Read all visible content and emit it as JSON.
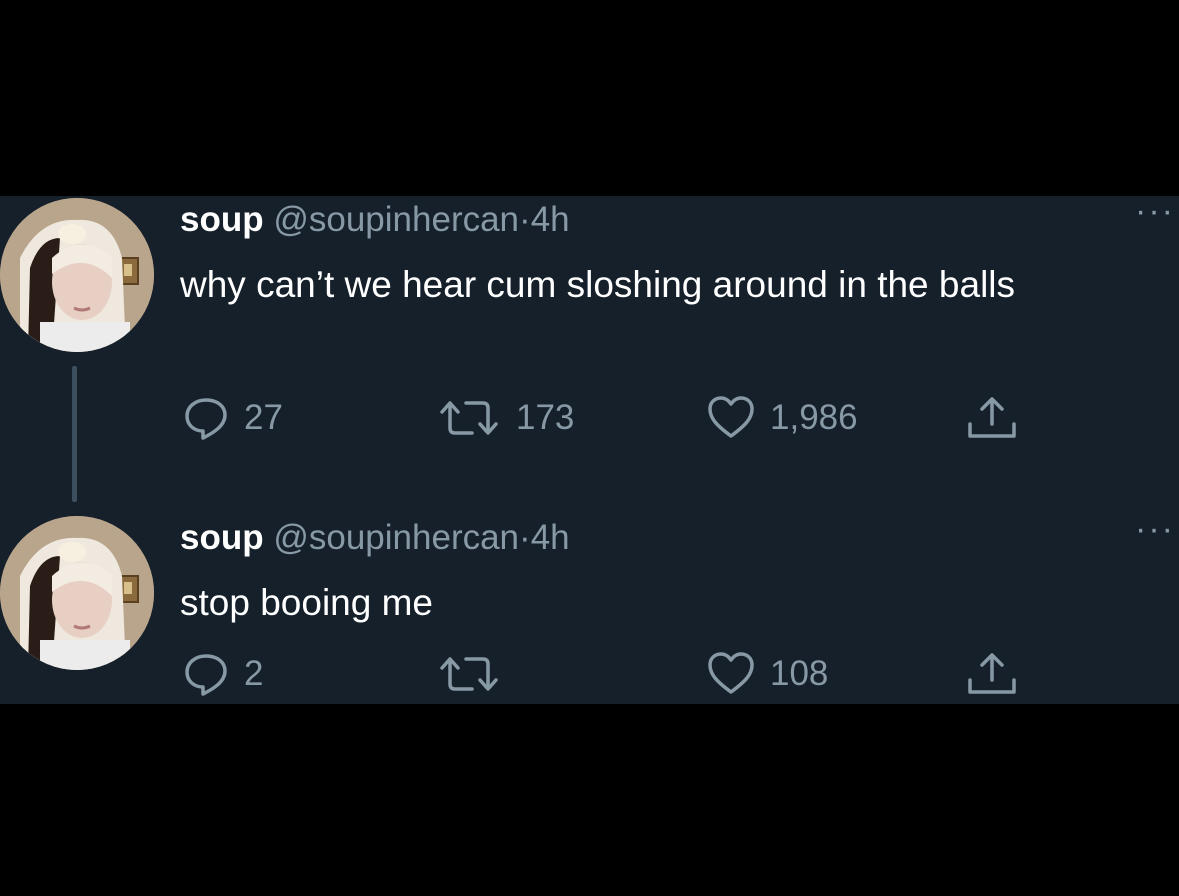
{
  "colors": {
    "background": "#15202b",
    "letterbox": "#000000",
    "text_primary": "#ffffff",
    "text_secondary": "#8899a6",
    "thread_line": "#3d4e5f"
  },
  "tweets": [
    {
      "name": "soup",
      "handle": "@soupinhercan",
      "separator": "·",
      "time": "4h",
      "more": "···",
      "text": "why can’t we hear cum sloshing around in the balls",
      "replies": "27",
      "retweets": "173",
      "likes": "1,986",
      "icons": [
        "reply-icon",
        "retweet-icon",
        "like-icon",
        "share-icon"
      ]
    },
    {
      "name": "soup",
      "handle": "@soupinhercan",
      "separator": "·",
      "time": "4h",
      "more": "···",
      "text": "stop booing me",
      "replies": "2",
      "retweets": "",
      "likes": "108",
      "icons": [
        "reply-icon",
        "retweet-icon",
        "like-icon",
        "share-icon"
      ]
    }
  ]
}
